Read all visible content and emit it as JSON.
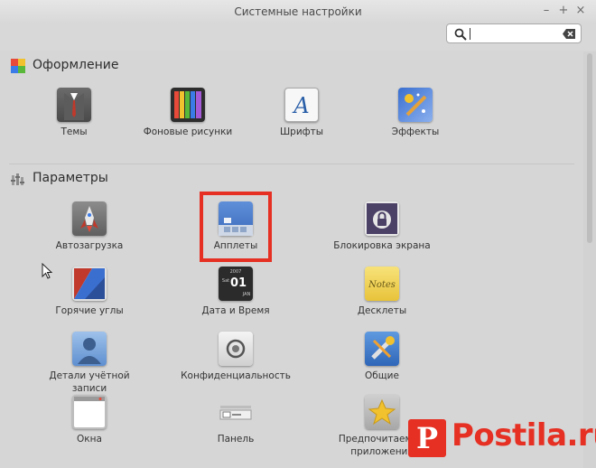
{
  "window": {
    "title": "Системные настройки",
    "minimize": "–",
    "maximize": "+",
    "close": "×"
  },
  "search": {
    "value": "",
    "placeholder": ""
  },
  "sections": {
    "appearance": {
      "title": "Оформление",
      "items": [
        {
          "label": "Темы",
          "icon": "themes-icon"
        },
        {
          "label": "Фоновые рисунки",
          "icon": "backgrounds-icon"
        },
        {
          "label": "Шрифты",
          "icon": "fonts-icon"
        },
        {
          "label": "Эффекты",
          "icon": "effects-icon"
        }
      ]
    },
    "preferences": {
      "title": "Параметры",
      "items": [
        {
          "label": "Автозагрузка",
          "icon": "startup-icon"
        },
        {
          "label": "Апплеты",
          "icon": "applets-icon"
        },
        {
          "label": "Блокировка экрана",
          "icon": "screensaver-icon"
        },
        {
          "label": "Горячие углы",
          "icon": "hot-corners-icon"
        },
        {
          "label": "Дата и Время",
          "icon": "date-time-icon"
        },
        {
          "label": "Десклеты",
          "icon": "desklets-icon"
        },
        {
          "label": "Детали учётной записи",
          "icon": "account-icon"
        },
        {
          "label": "Конфиденциальность",
          "icon": "privacy-icon"
        },
        {
          "label": "Общие",
          "icon": "general-icon"
        },
        {
          "label": "Окна",
          "icon": "windows-icon"
        },
        {
          "label": "Панель",
          "icon": "panel-icon"
        },
        {
          "label": "Предпочитаемые приложения",
          "icon": "preferred-apps-icon"
        }
      ]
    }
  },
  "date_icon": {
    "year": "2007",
    "day": "01",
    "month": "JAN",
    "weekday": "Sat"
  },
  "watermark": {
    "letter": "P",
    "text": "Postila.ru"
  },
  "colors": {
    "highlight": "#e53023",
    "background": "#d6d6d6"
  }
}
